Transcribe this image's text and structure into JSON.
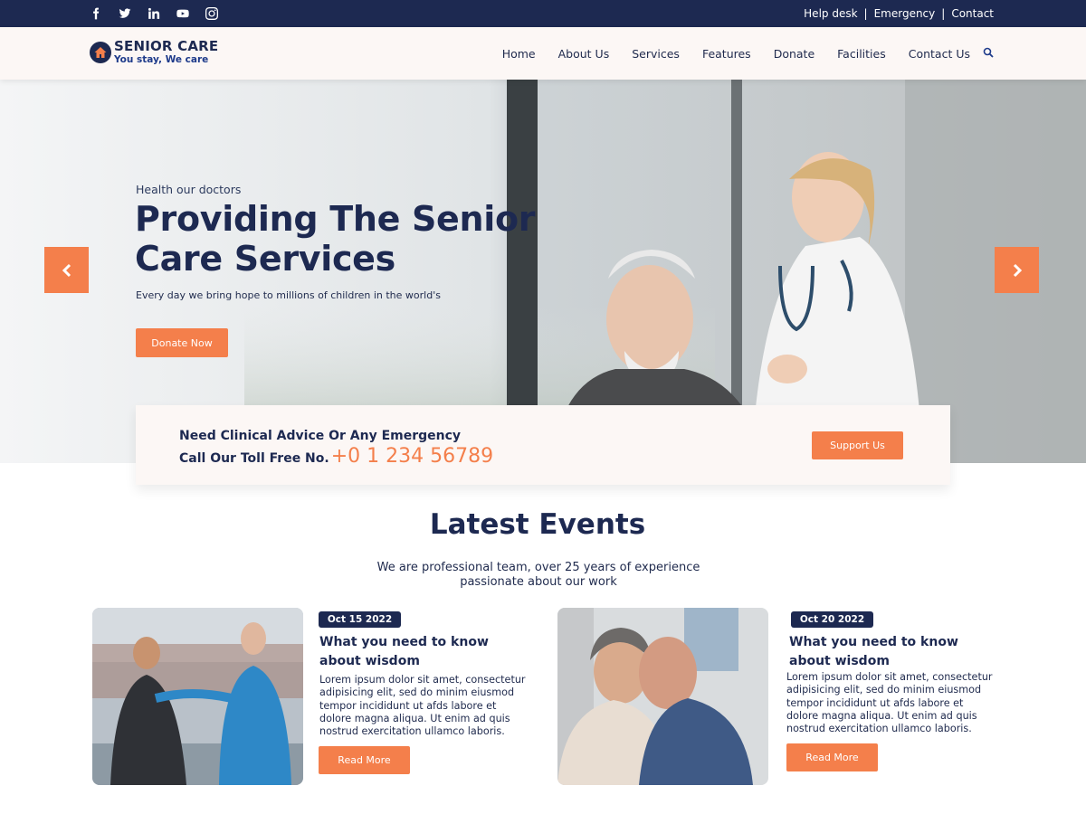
{
  "topbar": {
    "social_icons": [
      "facebook-icon",
      "twitter-icon",
      "linkedin-icon",
      "youtube-icon",
      "instagram-icon"
    ],
    "links": [
      "Help desk",
      "Emergency",
      "Contact"
    ],
    "separator": "|"
  },
  "header": {
    "brand": "SENIOR CARE",
    "tagline": "You stay, We care",
    "nav": [
      "Home",
      "About Us",
      "Services",
      "Features",
      "Donate",
      "Facilities",
      "Contact Us"
    ]
  },
  "hero": {
    "eyebrow": "Health our doctors",
    "title": "Providing The Senior Care Services",
    "description": "Every day we bring hope to millions of children in the world's",
    "cta": "Donate Now"
  },
  "emergency": {
    "line1": "Need Clinical Advice Or Any Emergency",
    "line2": "Call Our Toll Free No.",
    "phone": "+0 1 234 56789",
    "cta": "Support Us"
  },
  "events": {
    "title": "Latest Events",
    "subtitle_line1": "We are professional team, over 25 years of experience",
    "subtitle_line2": "passionate about our work",
    "items": [
      {
        "date": "Oct 15 2022",
        "title_line1": "What you need to know",
        "title_line2": "about wisdom",
        "body": [
          "Lorem ipsum dolor sit amet, consectetur",
          "adipisicing elit, sed do minim eiusmod",
          "tempor incididunt ut afds labore et",
          "dolore magna aliqua. Ut enim ad quis",
          "nostrud exercitation ullamco laboris."
        ],
        "cta": "Read More"
      },
      {
        "date": "Oct 20 2022",
        "title_line1": "What you need to know",
        "title_line2": "about wisdom",
        "body": [
          "Lorem ipsum dolor sit amet, consectetur",
          "adipisicing elit, sed do minim eiusmod",
          "tempor incididunt ut afds labore et",
          "dolore magna aliqua. Ut enim ad quis",
          "nostrud exercitation ullamco laboris."
        ],
        "cta": "Read More"
      }
    ]
  },
  "colors": {
    "navy": "#1d2951",
    "accent": "#f47f4b",
    "header_bg": "#fcf7f5"
  }
}
